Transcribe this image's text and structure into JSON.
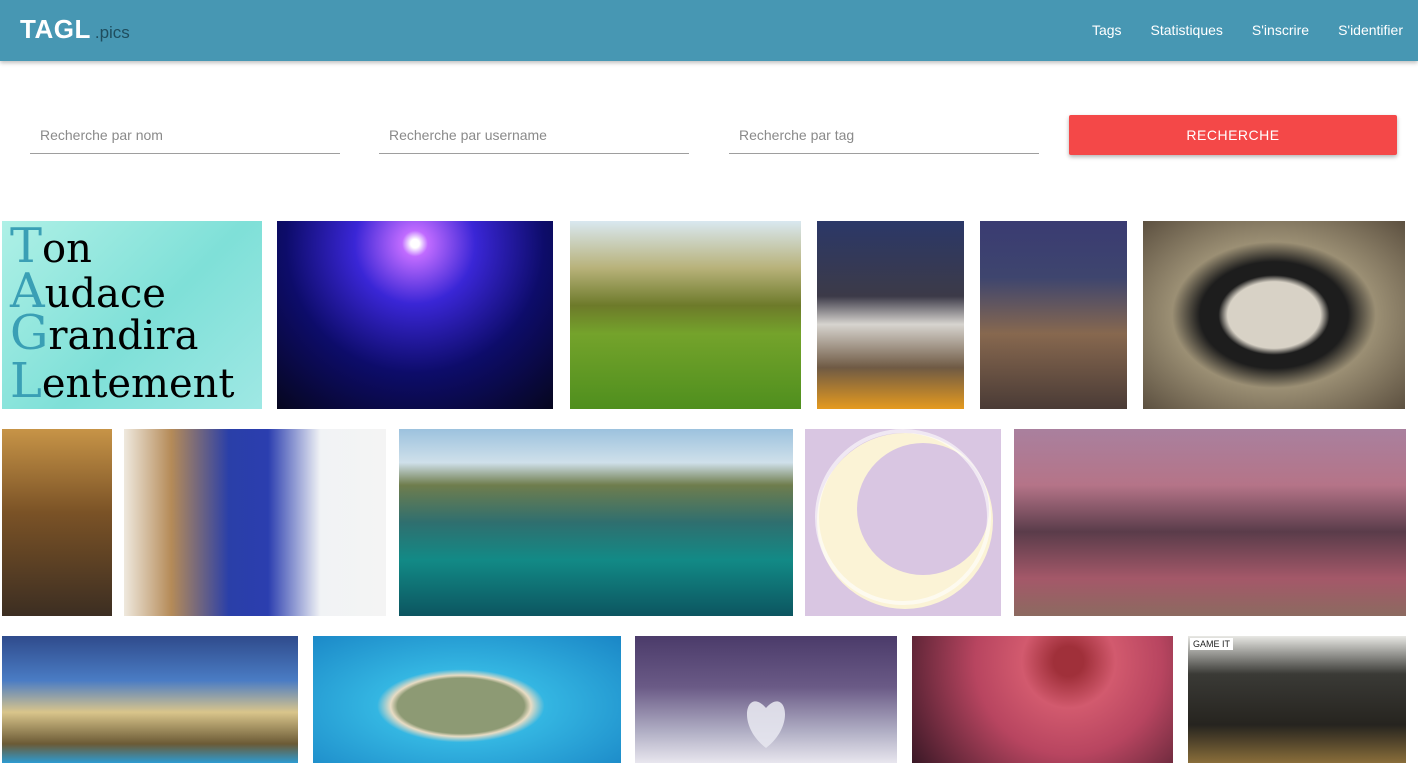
{
  "header": {
    "brand_main": "TAGL",
    "brand_sub": ".pics",
    "nav": [
      "Tags",
      "Statistiques",
      "S'inscrire",
      "S'identifier"
    ],
    "accent_color": "#4797b3"
  },
  "search": {
    "name_placeholder": "Recherche par nom",
    "username_placeholder": "Recherche par username",
    "tag_placeholder": "Recherche par tag",
    "button_label": "RECHERCHE",
    "button_color": "#f44848"
  },
  "gallery": {
    "acronym": [
      {
        "initial": "T",
        "rest": "on"
      },
      {
        "initial": "A",
        "rest": "udace"
      },
      {
        "initial": "G",
        "rest": "randira"
      },
      {
        "initial": "L",
        "rest": "entement"
      }
    ],
    "watermarks": {
      "gameit": "GAME IT"
    }
  }
}
